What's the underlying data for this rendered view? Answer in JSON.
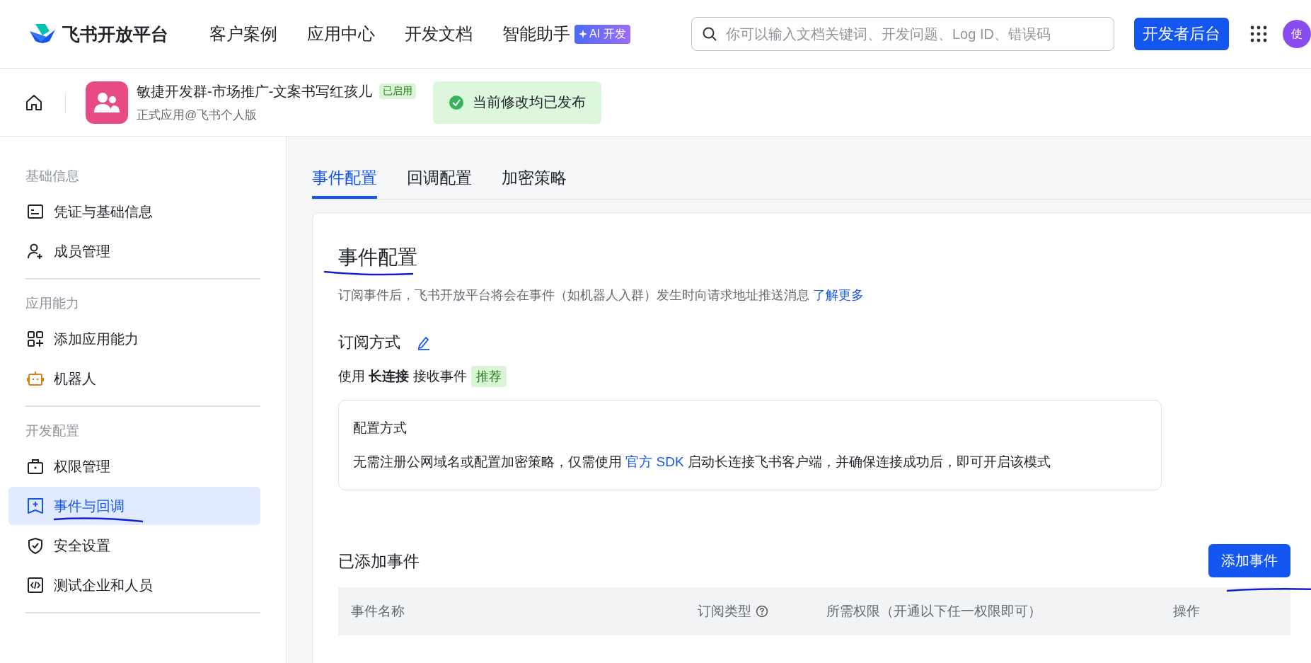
{
  "header": {
    "brand": "飞书开放平台",
    "nav": [
      {
        "label": "客户案例"
      },
      {
        "label": "应用中心"
      },
      {
        "label": "开发文档"
      },
      {
        "label": "智能助手",
        "badge": "AI 开发"
      }
    ],
    "search": {
      "placeholder": "你可以输入文档关键词、开发问题、Log ID、错误码"
    },
    "console_button": "开发者后台",
    "avatar": "使"
  },
  "app_bar": {
    "name": "敏捷开发群-市场推广-文案书写红孩儿",
    "status": "已启用",
    "subtitle": "正式应用@飞书个人版",
    "notice": "当前修改均已发布"
  },
  "sidebar": {
    "sections": [
      {
        "title": "基础信息",
        "items": [
          {
            "label": "凭证与基础信息",
            "selected": false
          },
          {
            "label": "成员管理",
            "selected": false
          }
        ]
      },
      {
        "title": "应用能力",
        "items": [
          {
            "label": "添加应用能力",
            "selected": false
          },
          {
            "label": "机器人",
            "selected": false
          }
        ]
      },
      {
        "title": "开发配置",
        "items": [
          {
            "label": "权限管理",
            "selected": false
          },
          {
            "label": "事件与回调",
            "selected": true
          },
          {
            "label": "安全设置",
            "selected": false
          },
          {
            "label": "测试企业和人员",
            "selected": false
          }
        ]
      }
    ]
  },
  "tabs": [
    {
      "label": "事件配置",
      "selected": true
    },
    {
      "label": "回调配置",
      "selected": false
    },
    {
      "label": "加密策略",
      "selected": false
    }
  ],
  "panel": {
    "title": "事件配置",
    "description": "订阅事件后，飞书开放平台将会在事件（如机器人入群）发生时向请求地址推送消息",
    "learn_more": "了解更多",
    "subscription": {
      "label": "订阅方式",
      "mode_text": "使用 **长连接** 接收事件",
      "tag": "推荐",
      "config_title": "配置方式",
      "config_before": "无需注册公网域名或配置加密策略，仅需使用",
      "config_link": "官方 SDK",
      "config_after": "启动长连接飞书客户端，并确保连接成功后，即可开启该模式"
    },
    "events": {
      "title": "已添加事件",
      "add_button": "添加事件",
      "columns": [
        {
          "label": "事件名称",
          "help": false
        },
        {
          "label": "订阅类型",
          "help": true
        },
        {
          "label": "所需权限（开通以下任一权限即可）",
          "help": false
        },
        {
          "label": "操作",
          "help": false
        }
      ]
    }
  }
}
